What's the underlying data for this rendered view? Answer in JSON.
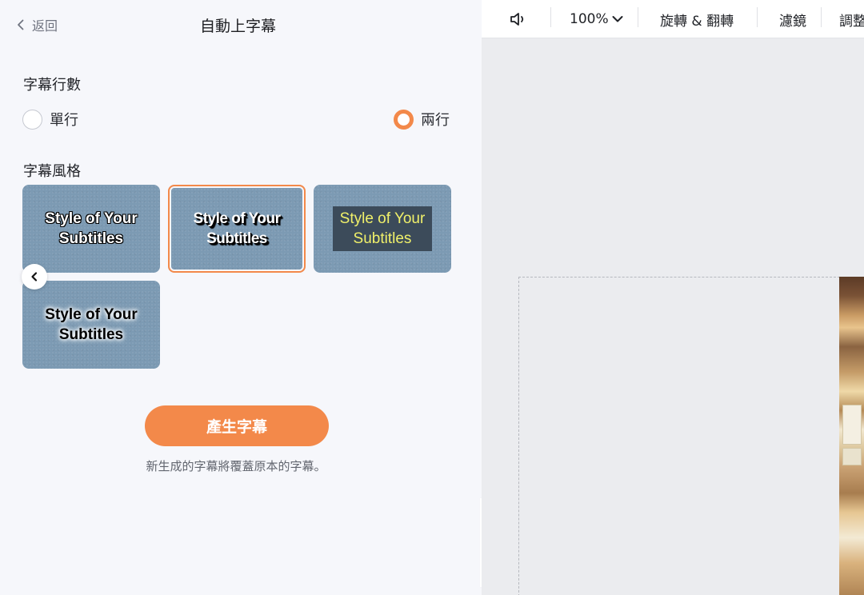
{
  "panel": {
    "back_label": "返回",
    "title": "自動上字幕"
  },
  "lines_section": {
    "title": "字幕行數",
    "options": [
      {
        "label": "單行",
        "selected": false
      },
      {
        "label": "兩行",
        "selected": true
      }
    ]
  },
  "style_section": {
    "title": "字幕風格",
    "cards": [
      {
        "line1": "Style of Your",
        "line2": "Subtitles",
        "selected": false
      },
      {
        "line1": "Style of Your",
        "line2": "Subtitles",
        "selected": true
      },
      {
        "line1": "Style of Your",
        "line2": "Subtitles",
        "selected": false
      },
      {
        "line1": "Style of Your",
        "line2": "Subtitles",
        "selected": false
      }
    ]
  },
  "generate": {
    "button_label": "產生字幕",
    "hint": "新生成的字幕將覆蓋原本的字幕。"
  },
  "toolbar": {
    "zoom": "100%",
    "rotate_flip": "旋轉 & 翻轉",
    "filter": "濾鏡",
    "adjust": "調整"
  },
  "colors": {
    "accent": "#f3894a",
    "card_bg": "#7c9ab3",
    "panel_bg": "#f6f7fb",
    "canvas_bg": "#ebecef"
  },
  "icons": {
    "back": "chevron-left-icon",
    "carousel_prev": "chevron-left-icon",
    "volume": "speaker-icon",
    "zoom_dropdown": "chevron-down-icon",
    "collapse": "chevron-left-icon"
  }
}
